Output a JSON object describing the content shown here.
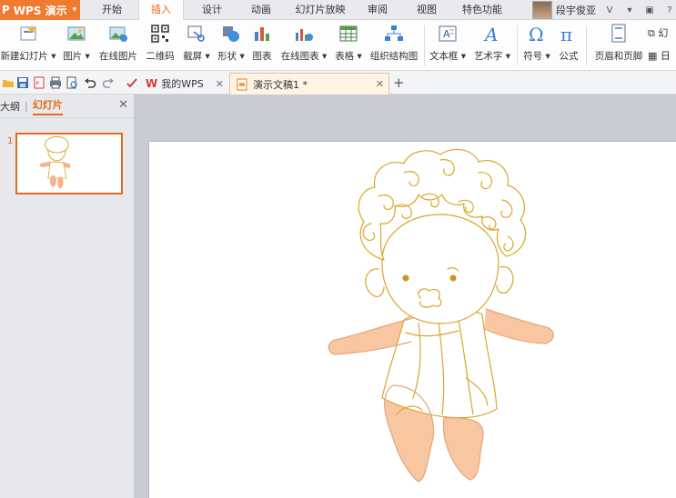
{
  "app": {
    "logo": "P",
    "name": "WPS 演示"
  },
  "menu_tabs": [
    {
      "label": "开始"
    },
    {
      "label": "插入"
    },
    {
      "label": "设计"
    },
    {
      "label": "动画"
    },
    {
      "label": "幻灯片放映"
    },
    {
      "label": "审阅"
    },
    {
      "label": "视图"
    },
    {
      "label": "特色功能"
    }
  ],
  "active_menu_tab": "插入",
  "user": {
    "name": "段宇俊亚"
  },
  "ribbon": {
    "new_slide": "新建幻灯片",
    "picture": "图片",
    "online_picture": "在线图片",
    "qrcode": "二维码",
    "screenshot": "截屏",
    "shape": "形状",
    "chart": "图表",
    "online_chart": "在线图表",
    "table": "表格",
    "org_chart": "组织结构图",
    "textbox": "文本框",
    "wordart": "艺术字",
    "symbol": "符号",
    "formula": "公式",
    "header_footer": "页眉和页脚",
    "overflow_1": "幻",
    "overflow_2": "日"
  },
  "doc_tabs": [
    {
      "label": "我的WPS"
    },
    {
      "label": "演示文稿1 *"
    }
  ],
  "left_panel": {
    "outline_tab": "大纲",
    "slides_tab": "幻灯片",
    "slide_number": "1"
  },
  "colors": {
    "accent": "#e46a1b",
    "app_orange": "#f07a2f",
    "line": "#d9a62a",
    "skin": "#f5c4a0"
  }
}
